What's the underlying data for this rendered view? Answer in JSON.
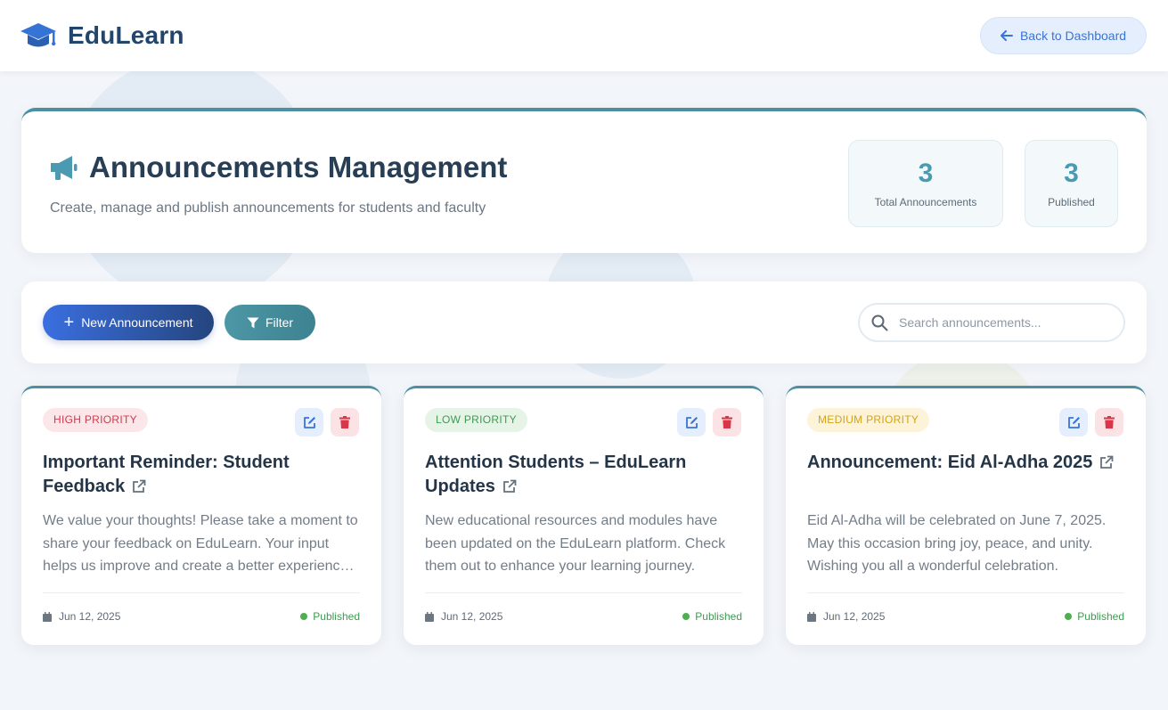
{
  "app": {
    "name": "EduLearn"
  },
  "header": {
    "back_label": "Back to Dashboard"
  },
  "hero": {
    "title": "Announcements Management",
    "subtitle": "Create, manage and publish announcements for students and faculty",
    "stats": [
      {
        "value": "3",
        "label": "Total Announcements"
      },
      {
        "value": "3",
        "label": "Published"
      }
    ]
  },
  "toolbar": {
    "new_label": "New Announcement",
    "filter_label": "Filter",
    "search_placeholder": "Search announcements..."
  },
  "cards": [
    {
      "priority": "HIGH PRIORITY",
      "title": "Important Reminder: Student Feedback",
      "body": "We value your thoughts! Please take a moment to share your feedback on EduLearn. Your input helps us improve and create a better experience for everyone.",
      "date": "Jun 12, 2025",
      "status": "Published"
    },
    {
      "priority": "LOW PRIORITY",
      "title": "Attention Students – EduLearn Updates",
      "body": "New educational resources and modules have been updated on the EduLearn platform. Check them out to enhance your learning journey.",
      "date": "Jun 12, 2025",
      "status": "Published"
    },
    {
      "priority": "MEDIUM PRIORITY",
      "title": "Announcement: Eid Al-Adha 2025",
      "body": "Eid Al-Adha will be celebrated on June 7, 2025. May this occasion bring joy, peace, and unity. Wishing you all a wonderful celebration.",
      "date": "Jun 12, 2025",
      "status": "Published"
    }
  ],
  "colors": {
    "brand": "#22456b",
    "accent_teal": "#4b8fa0",
    "primary_blue": "#3a6fe0",
    "high": "#d13a4c",
    "low": "#3f9a52",
    "medium": "#d4a317"
  },
  "icons": {
    "logo": "graduation-cap-icon",
    "back": "arrow-left-icon",
    "hero": "megaphone-icon",
    "new": "plus-icon",
    "filter": "funnel-icon",
    "search": "search-icon",
    "edit": "edit-icon",
    "delete": "trash-icon",
    "external": "external-link-icon",
    "date": "calendar-icon"
  }
}
